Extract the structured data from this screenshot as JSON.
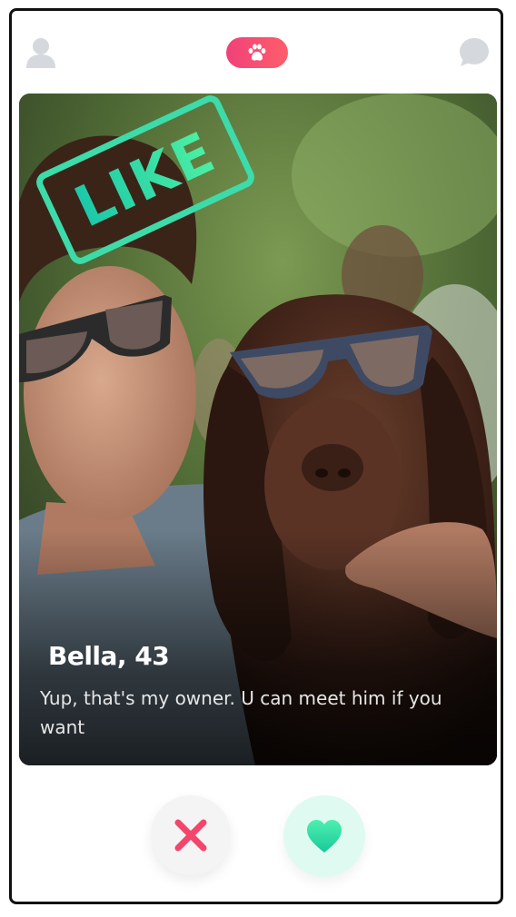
{
  "header": {
    "profile_icon": "user-icon",
    "logo_icon": "paw-icon",
    "messages_icon": "chat-bubble-icon"
  },
  "card": {
    "stamp_text": "LIKE",
    "name_age": "Bella, 43",
    "bio": "Yup, that's my owner. U can meet him if you want",
    "photo_description_icon": "photo"
  },
  "actions": {
    "dislike_icon": "close-icon",
    "like_icon": "heart-icon"
  },
  "colors": {
    "brand_pink": "#f0417a",
    "like_green": "#3ddbaa",
    "dislike_red": "#f2476b",
    "icon_gray": "#d5d9de"
  }
}
